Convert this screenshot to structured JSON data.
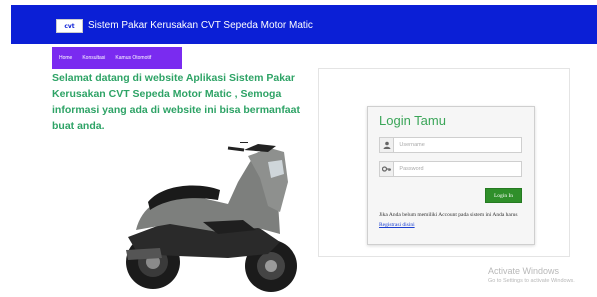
{
  "header": {
    "logo_text": "cvt",
    "title": "Sistem Pakar Kerusakan CVT Sepeda Motor Matic",
    "bg_color": "#0b1fd6"
  },
  "nav": {
    "bg_color": "#7a2bf0",
    "items": [
      {
        "label": "Home"
      },
      {
        "label": "Konsultasi"
      },
      {
        "label": "Kamus Otomotif"
      }
    ]
  },
  "welcome": {
    "text": "Selamat datang di website Aplikasi Sistem Pakar Kerusakan CVT Sepeda Motor Matic , Semoga informasi yang ada di website ini bisa bermanfaat buat anda.",
    "color": "#2ea366"
  },
  "login": {
    "title": "Login Tamu",
    "username_placeholder": "Username",
    "password_placeholder": "Password",
    "username_icon": "user-icon",
    "password_icon": "key-icon",
    "button_label": "Login In",
    "note_prefix": "Jika Anda belum memiliki Account pada sistem ini Anda harus",
    "note_link": "Registrasi disini",
    "title_color": "#3aa558",
    "button_color": "#2f8f2a"
  },
  "watermark": {
    "line1": "Activate Windows",
    "line2": "Go to Settings to activate Windows."
  }
}
